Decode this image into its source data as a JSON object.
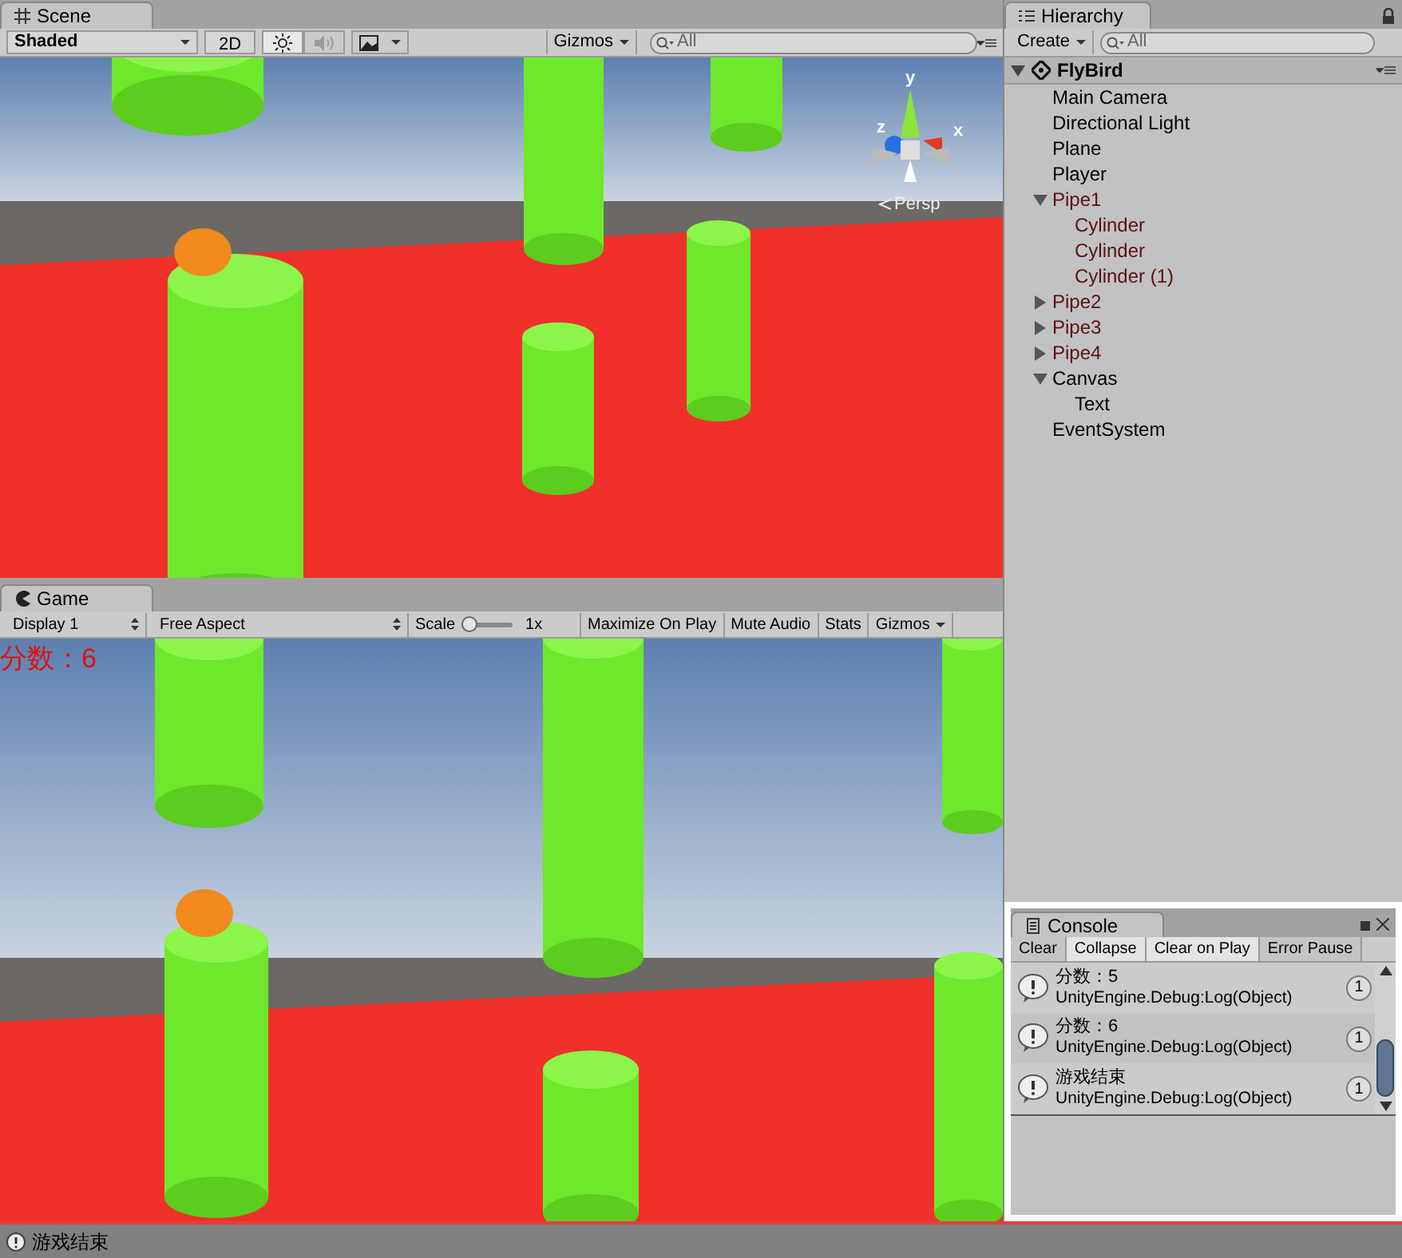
{
  "scene": {
    "tab": "Scene",
    "toolbar": {
      "draw_mode": "Shaded",
      "mode_2d": "2D",
      "lighting_on": true,
      "audio_on": false,
      "gizmos": "Gizmos",
      "search_placeholder": "All"
    },
    "gizmo": {
      "axes": [
        "y",
        "z",
        "x"
      ],
      "projection": "Persp"
    }
  },
  "game": {
    "tab": "Game",
    "toolbar": {
      "display": "Display 1",
      "aspect": "Free Aspect",
      "scale_label": "Scale",
      "scale": {
        "level": 0
      },
      "scale_value": "1x",
      "buttons": [
        "Maximize On Play",
        "Mute Audio",
        "Stats"
      ],
      "gizmos": "Gizmos"
    },
    "score_text": "分数：6"
  },
  "hierarchy": {
    "tab": "Hierarchy",
    "create": "Create",
    "search_placeholder": "All",
    "scene": {
      "name": "FlyBird",
      "expanded": true,
      "children": [
        {
          "name": "Main Camera",
          "prefab": false
        },
        {
          "name": "Directional Light",
          "prefab": false
        },
        {
          "name": "Plane",
          "prefab": false
        },
        {
          "name": "Player",
          "prefab": false
        },
        {
          "name": "Pipe1",
          "prefab": true,
          "expanded": true,
          "children": [
            {
              "name": "Cylinder",
              "prefab": true
            },
            {
              "name": "Cylinder",
              "prefab": true
            },
            {
              "name": "Cylinder (1)",
              "prefab": true
            }
          ]
        },
        {
          "name": "Pipe2",
          "prefab": true,
          "expanded": false
        },
        {
          "name": "Pipe3",
          "prefab": true,
          "expanded": false
        },
        {
          "name": "Pipe4",
          "prefab": true,
          "expanded": false
        },
        {
          "name": "Canvas",
          "prefab": false,
          "expanded": true,
          "children": [
            {
              "name": "Text",
              "prefab": false
            }
          ]
        },
        {
          "name": "EventSystem",
          "prefab": false
        }
      ]
    }
  },
  "console": {
    "tab": "Console",
    "buttons": [
      {
        "label": "Clear",
        "on": false
      },
      {
        "label": "Collapse",
        "on": true
      },
      {
        "label": "Clear on Play",
        "on": true
      },
      {
        "label": "Error Pause",
        "on": false
      }
    ],
    "entries": [
      {
        "message": "分数：5",
        "trace": "UnityEngine.Debug:Log(Object)",
        "count": "1"
      },
      {
        "message": "分数：6",
        "trace": "UnityEngine.Debug:Log(Object)",
        "count": "1"
      },
      {
        "message": "游戏结束",
        "trace": "UnityEngine.Debug:Log(Object)",
        "count": "1"
      }
    ]
  },
  "status_bar": {
    "message": "游戏结束"
  }
}
